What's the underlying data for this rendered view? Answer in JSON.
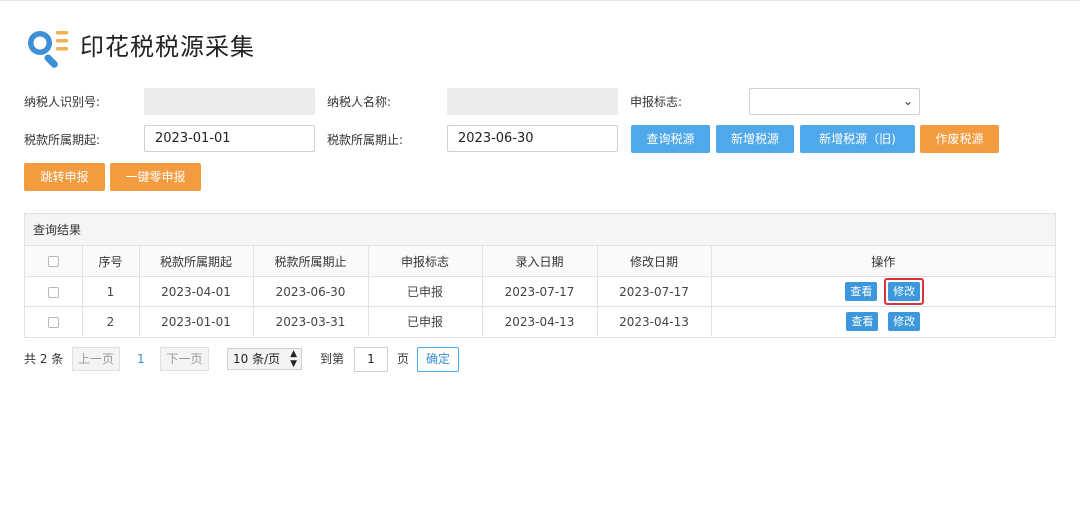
{
  "header": {
    "title": "印花税税源采集"
  },
  "form": {
    "taxpayer_id_label": "纳税人识别号:",
    "taxpayer_name_label": "纳税人名称:",
    "declare_flag_label": "申报标志:",
    "declare_flag_value": "",
    "period_start_label": "税款所属期起:",
    "period_start_value": "2023-01-01",
    "period_end_label": "税款所属期止:",
    "period_end_value": "2023-06-30"
  },
  "buttons": {
    "query": "查询税源",
    "add": "新增税源",
    "add_old": "新增税源（旧)",
    "void": "作废税源",
    "jump": "跳转申报",
    "zero": "一键零申报"
  },
  "results": {
    "title": "查询结果",
    "columns": [
      "序号",
      "税款所属期起",
      "税款所属期止",
      "申报标志",
      "录入日期",
      "修改日期",
      "操作"
    ],
    "rows": [
      {
        "no": "1",
        "start": "2023-04-01",
        "end": "2023-06-30",
        "flag": "已申报",
        "entry": "2023-07-17",
        "modified": "2023-07-17"
      },
      {
        "no": "2",
        "start": "2023-01-01",
        "end": "2023-03-31",
        "flag": "已申报",
        "entry": "2023-04-13",
        "modified": "2023-04-13"
      }
    ],
    "view_label": "查看",
    "edit_label": "修改"
  },
  "pagination": {
    "total": "共 2 条",
    "prev": "上一页",
    "current": "1",
    "next": "下一页",
    "page_size": "10 条/页",
    "goto": "到第",
    "goto_value": "1",
    "page_unit": "页",
    "confirm": "确定"
  },
  "colors": {
    "primary_blue": "#4fa8ea",
    "orange": "#f39b3f",
    "highlight_red": "#d9343a"
  },
  "icons": {
    "logo": "search-list-icon",
    "select": "chevron-down-icon",
    "page_size": "up-down-arrows-icon"
  }
}
